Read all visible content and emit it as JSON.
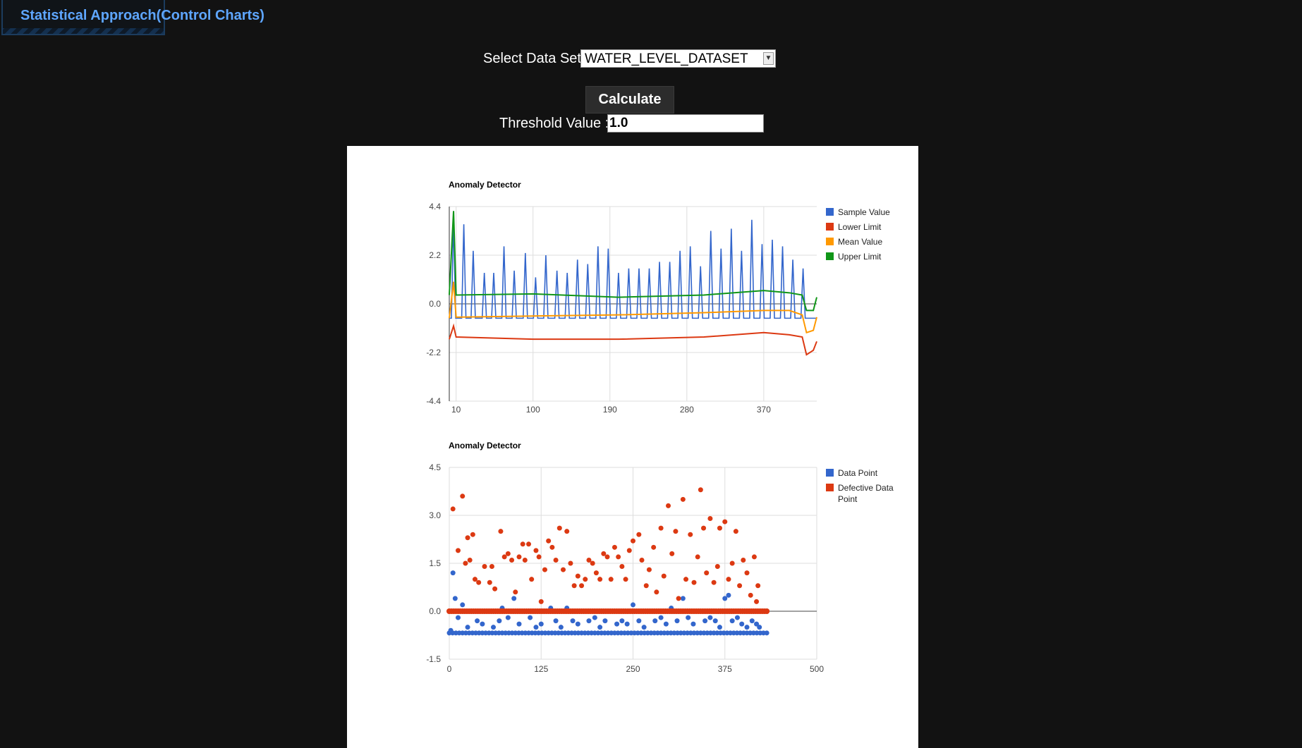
{
  "tab": {
    "label": "Statistical Approach(Control Charts)"
  },
  "controls": {
    "dataset_label": "Select Data Set",
    "dataset_value": "WATER_LEVEL_DATASET",
    "calculate_label": "Calculate",
    "threshold_label": "Threshold Value :",
    "threshold_value": "1.0"
  },
  "chart_data": [
    {
      "type": "line",
      "title": "Anomaly Detector",
      "ylim": [
        -4.4,
        4.4
      ],
      "yticks": [
        "4.4",
        "2.2",
        "0.0",
        "-2.2",
        "-4.4"
      ],
      "xticks": [
        "10",
        "100",
        "190",
        "280",
        "370"
      ],
      "xlim": [
        2,
        432
      ],
      "grid": true,
      "legend_position": "right",
      "series": [
        {
          "name": "Sample Value",
          "color": "#3366cc"
        },
        {
          "name": "Lower Limit",
          "color": "#dc3912"
        },
        {
          "name": "Mean Value",
          "color": "#ff9900"
        },
        {
          "name": "Upper Limit",
          "color": "#109618"
        }
      ],
      "sample_peaks": [
        {
          "x": 7,
          "y": 3.8
        },
        {
          "x": 19,
          "y": 3.6
        },
        {
          "x": 30,
          "y": 2.4
        },
        {
          "x": 43,
          "y": 1.4
        },
        {
          "x": 54,
          "y": 1.4
        },
        {
          "x": 66,
          "y": 2.6
        },
        {
          "x": 78,
          "y": 1.5
        },
        {
          "x": 91,
          "y": 2.3
        },
        {
          "x": 103,
          "y": 1.2
        },
        {
          "x": 115,
          "y": 2.2
        },
        {
          "x": 128,
          "y": 1.5
        },
        {
          "x": 140,
          "y": 1.4
        },
        {
          "x": 152,
          "y": 2.0
        },
        {
          "x": 164,
          "y": 1.8
        },
        {
          "x": 176,
          "y": 2.6
        },
        {
          "x": 188,
          "y": 2.5
        },
        {
          "x": 200,
          "y": 1.4
        },
        {
          "x": 212,
          "y": 1.6
        },
        {
          "x": 224,
          "y": 1.6
        },
        {
          "x": 236,
          "y": 1.6
        },
        {
          "x": 248,
          "y": 1.9
        },
        {
          "x": 260,
          "y": 1.9
        },
        {
          "x": 272,
          "y": 2.4
        },
        {
          "x": 284,
          "y": 2.6
        },
        {
          "x": 296,
          "y": 1.7
        },
        {
          "x": 308,
          "y": 3.3
        },
        {
          "x": 320,
          "y": 2.5
        },
        {
          "x": 332,
          "y": 3.4
        },
        {
          "x": 344,
          "y": 2.4
        },
        {
          "x": 356,
          "y": 3.8
        },
        {
          "x": 368,
          "y": 2.7
        },
        {
          "x": 380,
          "y": 2.9
        },
        {
          "x": 392,
          "y": 2.6
        },
        {
          "x": 404,
          "y": 2.0
        },
        {
          "x": 416,
          "y": 1.6
        }
      ],
      "sample_baseline": -0.65,
      "mean_value": [
        {
          "x": 2,
          "y": -0.65
        },
        {
          "x": 7,
          "y": 1.0
        },
        {
          "x": 10,
          "y": -0.6
        },
        {
          "x": 100,
          "y": -0.55
        },
        {
          "x": 200,
          "y": -0.5
        },
        {
          "x": 300,
          "y": -0.4
        },
        {
          "x": 370,
          "y": -0.3
        },
        {
          "x": 400,
          "y": -0.3
        },
        {
          "x": 415,
          "y": -0.5
        },
        {
          "x": 420,
          "y": -1.3
        },
        {
          "x": 428,
          "y": -1.2
        },
        {
          "x": 432,
          "y": -0.6
        }
      ],
      "upper_limit": [
        {
          "x": 2,
          "y": 0.4
        },
        {
          "x": 7,
          "y": 4.2
        },
        {
          "x": 10,
          "y": 0.4
        },
        {
          "x": 100,
          "y": 0.45
        },
        {
          "x": 200,
          "y": 0.3
        },
        {
          "x": 300,
          "y": 0.4
        },
        {
          "x": 370,
          "y": 0.6
        },
        {
          "x": 400,
          "y": 0.5
        },
        {
          "x": 415,
          "y": 0.4
        },
        {
          "x": 420,
          "y": -0.3
        },
        {
          "x": 428,
          "y": -0.3
        },
        {
          "x": 432,
          "y": 0.3
        }
      ],
      "lower_limit": [
        {
          "x": 2,
          "y": -1.6
        },
        {
          "x": 7,
          "y": -1.0
        },
        {
          "x": 10,
          "y": -1.5
        },
        {
          "x": 100,
          "y": -1.6
        },
        {
          "x": 200,
          "y": -1.6
        },
        {
          "x": 300,
          "y": -1.5
        },
        {
          "x": 370,
          "y": -1.3
        },
        {
          "x": 400,
          "y": -1.4
        },
        {
          "x": 415,
          "y": -1.5
        },
        {
          "x": 420,
          "y": -2.3
        },
        {
          "x": 428,
          "y": -2.1
        },
        {
          "x": 432,
          "y": -1.7
        }
      ]
    },
    {
      "type": "scatter",
      "title": "Anomaly Detector",
      "ylim": [
        -1.5,
        4.5
      ],
      "yticks": [
        "4.5",
        "3.0",
        "1.5",
        "0.0",
        "-1.5"
      ],
      "xticks": [
        "0",
        "125",
        "250",
        "375",
        "500"
      ],
      "xlim": [
        0,
        500
      ],
      "grid": true,
      "legend_position": "right",
      "series": [
        {
          "name": "Data Point",
          "color": "#3366cc"
        },
        {
          "name": "Defective Data Point",
          "color": "#dc3912"
        }
      ],
      "defective_points": [
        [
          5,
          3.2
        ],
        [
          18,
          3.6
        ],
        [
          12,
          1.9
        ],
        [
          25,
          2.3
        ],
        [
          32,
          2.4
        ],
        [
          28,
          1.6
        ],
        [
          22,
          1.5
        ],
        [
          35,
          1.0
        ],
        [
          40,
          0.9
        ],
        [
          48,
          1.4
        ],
        [
          55,
          0.9
        ],
        [
          58,
          1.4
        ],
        [
          62,
          0.7
        ],
        [
          70,
          2.5
        ],
        [
          75,
          1.7
        ],
        [
          80,
          1.8
        ],
        [
          85,
          1.6
        ],
        [
          90,
          0.6
        ],
        [
          95,
          1.7
        ],
        [
          100,
          2.1
        ],
        [
          103,
          1.6
        ],
        [
          108,
          2.1
        ],
        [
          112,
          1.0
        ],
        [
          118,
          1.9
        ],
        [
          122,
          1.7
        ],
        [
          125,
          0.3
        ],
        [
          130,
          1.3
        ],
        [
          135,
          2.2
        ],
        [
          140,
          2.0
        ],
        [
          145,
          1.6
        ],
        [
          150,
          2.6
        ],
        [
          155,
          1.3
        ],
        [
          160,
          2.5
        ],
        [
          165,
          1.5
        ],
        [
          170,
          0.8
        ],
        [
          175,
          1.1
        ],
        [
          180,
          0.8
        ],
        [
          185,
          1.0
        ],
        [
          190,
          1.6
        ],
        [
          195,
          1.5
        ],
        [
          200,
          1.2
        ],
        [
          205,
          1.0
        ],
        [
          210,
          1.8
        ],
        [
          215,
          1.7
        ],
        [
          220,
          1.0
        ],
        [
          225,
          2.0
        ],
        [
          230,
          1.7
        ],
        [
          235,
          1.4
        ],
        [
          240,
          1.0
        ],
        [
          245,
          1.9
        ],
        [
          250,
          2.2
        ],
        [
          258,
          2.4
        ],
        [
          262,
          1.6
        ],
        [
          268,
          0.8
        ],
        [
          272,
          1.3
        ],
        [
          278,
          2.0
        ],
        [
          282,
          0.6
        ],
        [
          288,
          2.6
        ],
        [
          292,
          1.1
        ],
        [
          298,
          3.3
        ],
        [
          303,
          1.8
        ],
        [
          308,
          2.5
        ],
        [
          312,
          0.4
        ],
        [
          318,
          3.5
        ],
        [
          322,
          1.0
        ],
        [
          328,
          2.4
        ],
        [
          333,
          0.9
        ],
        [
          338,
          1.7
        ],
        [
          342,
          3.8
        ],
        [
          346,
          2.6
        ],
        [
          350,
          1.2
        ],
        [
          355,
          2.9
        ],
        [
          360,
          0.9
        ],
        [
          365,
          1.4
        ],
        [
          368,
          2.6
        ],
        [
          375,
          2.8
        ],
        [
          380,
          1.0
        ],
        [
          385,
          1.5
        ],
        [
          390,
          2.5
        ],
        [
          395,
          0.8
        ],
        [
          400,
          1.6
        ],
        [
          405,
          1.2
        ],
        [
          410,
          0.5
        ],
        [
          415,
          1.7
        ],
        [
          418,
          0.3
        ],
        [
          420,
          0.8
        ]
      ],
      "normal_points": [
        [
          2,
          -0.6
        ],
        [
          5,
          1.2
        ],
        [
          8,
          0.4
        ],
        [
          12,
          -0.2
        ],
        [
          18,
          0.2
        ],
        [
          25,
          -0.5
        ],
        [
          30,
          0.0
        ],
        [
          38,
          -0.3
        ],
        [
          45,
          -0.4
        ],
        [
          52,
          0.0
        ],
        [
          60,
          -0.5
        ],
        [
          68,
          -0.3
        ],
        [
          72,
          0.1
        ],
        [
          80,
          -0.2
        ],
        [
          88,
          0.4
        ],
        [
          95,
          -0.4
        ],
        [
          102,
          0.0
        ],
        [
          110,
          -0.2
        ],
        [
          118,
          -0.5
        ],
        [
          125,
          -0.4
        ],
        [
          130,
          0.0
        ],
        [
          138,
          0.1
        ],
        [
          145,
          -0.3
        ],
        [
          152,
          -0.5
        ],
        [
          160,
          0.1
        ],
        [
          168,
          -0.3
        ],
        [
          175,
          -0.4
        ],
        [
          182,
          0.0
        ],
        [
          190,
          -0.3
        ],
        [
          198,
          -0.2
        ],
        [
          205,
          -0.5
        ],
        [
          212,
          -0.3
        ],
        [
          220,
          0.0
        ],
        [
          228,
          -0.4
        ],
        [
          235,
          -0.3
        ],
        [
          242,
          -0.4
        ],
        [
          250,
          0.2
        ],
        [
          258,
          -0.3
        ],
        [
          265,
          -0.5
        ],
        [
          272,
          0.0
        ],
        [
          280,
          -0.3
        ],
        [
          288,
          -0.2
        ],
        [
          295,
          -0.4
        ],
        [
          302,
          0.1
        ],
        [
          310,
          -0.3
        ],
        [
          318,
          0.4
        ],
        [
          325,
          -0.2
        ],
        [
          332,
          -0.4
        ],
        [
          340,
          0.0
        ],
        [
          348,
          -0.3
        ],
        [
          355,
          -0.2
        ],
        [
          362,
          -0.3
        ],
        [
          368,
          -0.5
        ],
        [
          375,
          0.4
        ],
        [
          380,
          0.5
        ],
        [
          385,
          -0.3
        ],
        [
          392,
          -0.2
        ],
        [
          398,
          -0.4
        ],
        [
          405,
          -0.5
        ],
        [
          412,
          -0.3
        ],
        [
          418,
          -0.4
        ],
        [
          422,
          -0.5
        ]
      ]
    }
  ]
}
